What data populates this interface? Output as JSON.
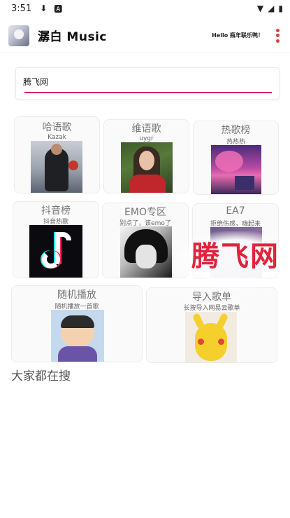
{
  "status_bar": {
    "time": "3:51",
    "icons": [
      "download-icon",
      "a-icon",
      "wifi-icon",
      "signal-icon",
      "battery-icon"
    ]
  },
  "app_bar": {
    "title": "潺白 Music",
    "greeting": "Hello 瓶年联乐鸭！",
    "menu_icon": "more-vertical-icon",
    "accent_color": "#e53935"
  },
  "search": {
    "value": "腾飞网",
    "placeholder": "",
    "underline_color": "#e91e63"
  },
  "categories": [
    {
      "title": "哈语歌",
      "subtitle": "Kazak",
      "cover": "singer-in-black-coat"
    },
    {
      "title": "维语歌",
      "subtitle": "uygr",
      "cover": "woman-in-red-dress"
    },
    {
      "title": "热歌榜",
      "subtitle": "热热热",
      "cover": "pink-night-scenery"
    },
    {
      "title": "抖音榜",
      "subtitle": "抖音热歌",
      "cover": "tiktok-logo"
    },
    {
      "title": "EMO专区",
      "subtitle": "别点了，该emo了",
      "cover": "emo-anime-boy"
    },
    {
      "title": "EA7",
      "subtitle": "拒绝伤感，嗨起来",
      "cover": "ea7-cover"
    },
    {
      "title": "随机播放",
      "subtitle": "随机播放一首歌",
      "cover": "crayon-shin-chan"
    },
    {
      "title": "导入歌单",
      "subtitle": "长按导入网易云歌单",
      "cover": "pikachu-plush"
    }
  ],
  "section": {
    "heading": "大家都在搜"
  },
  "watermark": {
    "text": "腾飞网",
    "color": "#e0243c"
  }
}
